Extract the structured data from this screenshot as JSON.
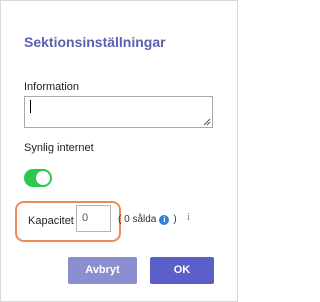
{
  "dialog": {
    "title": "Sektionsinställningar",
    "information_label": "Information",
    "information_value": "",
    "synlig_label": "Synlig internet",
    "synlig_on": true,
    "kapacitet_label": "Kapacitet",
    "kapacitet_value": "0",
    "sold_prefix": "( 0 sålda",
    "sold_suffix": ")",
    "info_glyph": "i",
    "info_plain_glyph": "i",
    "cancel_label": "Avbryt",
    "ok_label": "OK"
  },
  "colors": {
    "title": "#5d5fb0",
    "toggle_on": "#2cc84d",
    "highlight": "#ef8a56",
    "info_icon": "#2f7ed8",
    "cancel_button": "#8b8fd0",
    "ok_button": "#5a5fc9"
  },
  "icons": {
    "toggle": "toggle-switch-icon",
    "info": "info-circle-icon",
    "info_plain": "info-icon",
    "resize": "resize-grip-icon"
  }
}
